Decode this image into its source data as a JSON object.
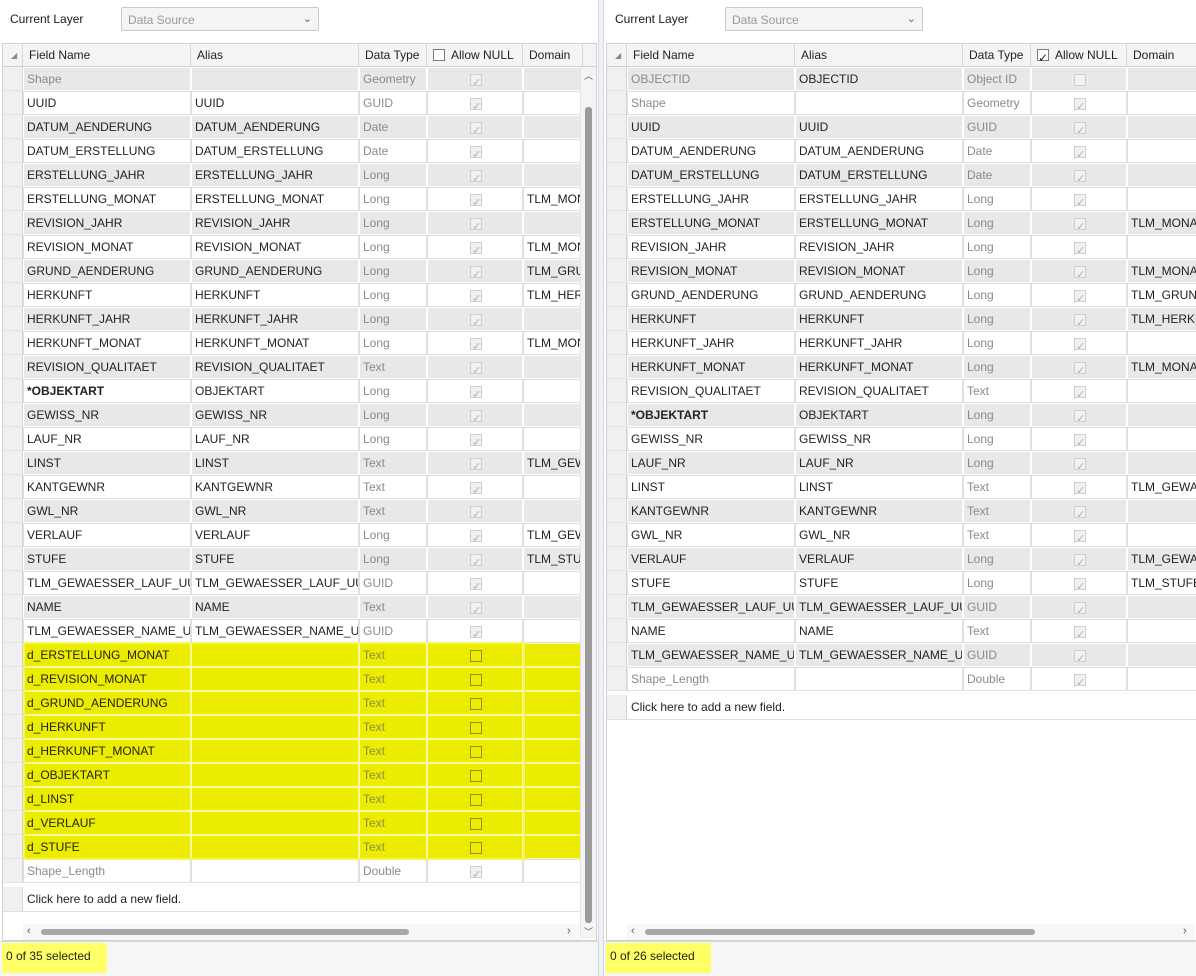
{
  "left": {
    "current_layer_label": "Current Layer",
    "data_source": "Data Source",
    "columns": [
      "Field Name",
      "Alias",
      "Data Type",
      "Allow NULL",
      "Domain"
    ],
    "allow_null_header_checked": false,
    "rows": [
      {
        "name": "Shape",
        "alias": "",
        "type": "Geometry",
        "null": true,
        "domain": "",
        "dim": true
      },
      {
        "name": "UUID",
        "alias": "UUID",
        "type": "GUID",
        "null": true,
        "domain": ""
      },
      {
        "name": "DATUM_AENDERUNG",
        "alias": "DATUM_AENDERUNG",
        "type": "Date",
        "null": true,
        "domain": ""
      },
      {
        "name": "DATUM_ERSTELLUNG",
        "alias": "DATUM_ERSTELLUNG",
        "type": "Date",
        "null": true,
        "domain": ""
      },
      {
        "name": "ERSTELLUNG_JAHR",
        "alias": "ERSTELLUNG_JAHR",
        "type": "Long",
        "null": true,
        "domain": ""
      },
      {
        "name": "ERSTELLUNG_MONAT",
        "alias": "ERSTELLUNG_MONAT",
        "type": "Long",
        "null": true,
        "domain": "TLM_MON"
      },
      {
        "name": "REVISION_JAHR",
        "alias": "REVISION_JAHR",
        "type": "Long",
        "null": true,
        "domain": ""
      },
      {
        "name": "REVISION_MONAT",
        "alias": "REVISION_MONAT",
        "type": "Long",
        "null": true,
        "domain": "TLM_MON"
      },
      {
        "name": "GRUND_AENDERUNG",
        "alias": "GRUND_AENDERUNG",
        "type": "Long",
        "null": true,
        "domain": "TLM_GRU"
      },
      {
        "name": "HERKUNFT",
        "alias": "HERKUNFT",
        "type": "Long",
        "null": true,
        "domain": "TLM_HERK"
      },
      {
        "name": "HERKUNFT_JAHR",
        "alias": "HERKUNFT_JAHR",
        "type": "Long",
        "null": true,
        "domain": ""
      },
      {
        "name": "HERKUNFT_MONAT",
        "alias": "HERKUNFT_MONAT",
        "type": "Long",
        "null": true,
        "domain": "TLM_MON"
      },
      {
        "name": "REVISION_QUALITAET",
        "alias": "REVISION_QUALITAET",
        "type": "Text",
        "null": true,
        "domain": ""
      },
      {
        "name": "*OBJEKTART",
        "alias": "OBJEKTART",
        "type": "Long",
        "null": true,
        "domain": "",
        "bold": true
      },
      {
        "name": "GEWISS_NR",
        "alias": "GEWISS_NR",
        "type": "Long",
        "null": true,
        "domain": ""
      },
      {
        "name": "LAUF_NR",
        "alias": "LAUF_NR",
        "type": "Long",
        "null": true,
        "domain": ""
      },
      {
        "name": "LINST",
        "alias": "LINST",
        "type": "Text",
        "null": true,
        "domain": "TLM_GEW"
      },
      {
        "name": "KANTGEWNR",
        "alias": "KANTGEWNR",
        "type": "Text",
        "null": true,
        "domain": ""
      },
      {
        "name": "GWL_NR",
        "alias": "GWL_NR",
        "type": "Text",
        "null": true,
        "domain": ""
      },
      {
        "name": "VERLAUF",
        "alias": "VERLAUF",
        "type": "Long",
        "null": true,
        "domain": "TLM_GEW"
      },
      {
        "name": "STUFE",
        "alias": "STUFE",
        "type": "Long",
        "null": true,
        "domain": "TLM_STUF"
      },
      {
        "name": "TLM_GEWAESSER_LAUF_UUID",
        "alias": "TLM_GEWAESSER_LAUF_UUID",
        "type": "GUID",
        "null": true,
        "domain": ""
      },
      {
        "name": "NAME",
        "alias": "NAME",
        "type": "Text",
        "null": true,
        "domain": ""
      },
      {
        "name": "TLM_GEWAESSER_NAME_UUID",
        "alias": "TLM_GEWAESSER_NAME_UUID",
        "type": "GUID",
        "null": true,
        "domain": ""
      },
      {
        "name": "d_ERSTELLUNG_MONAT",
        "alias": "",
        "type": "Text",
        "null": false,
        "domain": "",
        "hl": true
      },
      {
        "name": "d_REVISION_MONAT",
        "alias": "",
        "type": "Text",
        "null": false,
        "domain": "",
        "hl": true
      },
      {
        "name": "d_GRUND_AENDERUNG",
        "alias": "",
        "type": "Text",
        "null": false,
        "domain": "",
        "hl": true
      },
      {
        "name": "d_HERKUNFT",
        "alias": "",
        "type": "Text",
        "null": false,
        "domain": "",
        "hl": true
      },
      {
        "name": "d_HERKUNFT_MONAT",
        "alias": "",
        "type": "Text",
        "null": false,
        "domain": "",
        "hl": true
      },
      {
        "name": "d_OBJEKTART",
        "alias": "",
        "type": "Text",
        "null": false,
        "domain": "",
        "hl": true
      },
      {
        "name": "d_LINST",
        "alias": "",
        "type": "Text",
        "null": false,
        "domain": "",
        "hl": true
      },
      {
        "name": "d_VERLAUF",
        "alias": "",
        "type": "Text",
        "null": false,
        "domain": "",
        "hl": true
      },
      {
        "name": "d_STUFE",
        "alias": "",
        "type": "Text",
        "null": false,
        "domain": "",
        "hl": true
      },
      {
        "name": "Shape_Length",
        "alias": "",
        "type": "Double",
        "null": true,
        "domain": "",
        "dim": true
      }
    ],
    "add_field": "Click here to add a new field.",
    "status": "0 of 35 selected"
  },
  "right": {
    "current_layer_label": "Current Layer",
    "data_source": "Data Source",
    "columns": [
      "Field Name",
      "Alias",
      "Data Type",
      "Allow NULL",
      "Domain"
    ],
    "allow_null_header_checked": true,
    "rows": [
      {
        "name": "OBJECTID",
        "alias": "OBJECTID",
        "type": "Object ID",
        "null": false,
        "domain": "",
        "dim": true
      },
      {
        "name": "Shape",
        "alias": "",
        "type": "Geometry",
        "null": true,
        "domain": "",
        "dim": true
      },
      {
        "name": "UUID",
        "alias": "UUID",
        "type": "GUID",
        "null": true,
        "domain": ""
      },
      {
        "name": "DATUM_AENDERUNG",
        "alias": "DATUM_AENDERUNG",
        "type": "Date",
        "null": true,
        "domain": ""
      },
      {
        "name": "DATUM_ERSTELLUNG",
        "alias": "DATUM_ERSTELLUNG",
        "type": "Date",
        "null": true,
        "domain": ""
      },
      {
        "name": "ERSTELLUNG_JAHR",
        "alias": "ERSTELLUNG_JAHR",
        "type": "Long",
        "null": true,
        "domain": ""
      },
      {
        "name": "ERSTELLUNG_MONAT",
        "alias": "ERSTELLUNG_MONAT",
        "type": "Long",
        "null": true,
        "domain": "TLM_MONAT"
      },
      {
        "name": "REVISION_JAHR",
        "alias": "REVISION_JAHR",
        "type": "Long",
        "null": true,
        "domain": ""
      },
      {
        "name": "REVISION_MONAT",
        "alias": "REVISION_MONAT",
        "type": "Long",
        "null": true,
        "domain": "TLM_MONAT"
      },
      {
        "name": "GRUND_AENDERUNG",
        "alias": "GRUND_AENDERUNG",
        "type": "Long",
        "null": true,
        "domain": "TLM_GRUND"
      },
      {
        "name": "HERKUNFT",
        "alias": "HERKUNFT",
        "type": "Long",
        "null": true,
        "domain": "TLM_HERKUI"
      },
      {
        "name": "HERKUNFT_JAHR",
        "alias": "HERKUNFT_JAHR",
        "type": "Long",
        "null": true,
        "domain": ""
      },
      {
        "name": "HERKUNFT_MONAT",
        "alias": "HERKUNFT_MONAT",
        "type": "Long",
        "null": true,
        "domain": "TLM_MONAT"
      },
      {
        "name": "REVISION_QUALITAET",
        "alias": "REVISION_QUALITAET",
        "type": "Text",
        "null": true,
        "domain": ""
      },
      {
        "name": "*OBJEKTART",
        "alias": "OBJEKTART",
        "type": "Long",
        "null": true,
        "domain": "",
        "bold": true
      },
      {
        "name": "GEWISS_NR",
        "alias": "GEWISS_NR",
        "type": "Long",
        "null": true,
        "domain": ""
      },
      {
        "name": "LAUF_NR",
        "alias": "LAUF_NR",
        "type": "Long",
        "null": true,
        "domain": ""
      },
      {
        "name": "LINST",
        "alias": "LINST",
        "type": "Text",
        "null": true,
        "domain": "TLM_GEWAE"
      },
      {
        "name": "KANTGEWNR",
        "alias": "KANTGEWNR",
        "type": "Text",
        "null": true,
        "domain": ""
      },
      {
        "name": "GWL_NR",
        "alias": "GWL_NR",
        "type": "Text",
        "null": true,
        "domain": ""
      },
      {
        "name": "VERLAUF",
        "alias": "VERLAUF",
        "type": "Long",
        "null": true,
        "domain": "TLM_GEWAE"
      },
      {
        "name": "STUFE",
        "alias": "STUFE",
        "type": "Long",
        "null": true,
        "domain": "TLM_STUFE_("
      },
      {
        "name": "TLM_GEWAESSER_LAUF_UUID",
        "alias": "TLM_GEWAESSER_LAUF_UUID",
        "type": "GUID",
        "null": true,
        "domain": ""
      },
      {
        "name": "NAME",
        "alias": "NAME",
        "type": "Text",
        "null": true,
        "domain": ""
      },
      {
        "name": "TLM_GEWAESSER_NAME_UUID",
        "alias": "TLM_GEWAESSER_NAME_UUID",
        "type": "GUID",
        "null": true,
        "domain": ""
      },
      {
        "name": "Shape_Length",
        "alias": "",
        "type": "Double",
        "null": true,
        "domain": "",
        "dim": true
      }
    ],
    "add_field": "Click here to add a new field.",
    "status": "0 of 26 selected"
  },
  "icons": {
    "dropdown": "chevron-down-icon",
    "check": "check-icon",
    "sort": "sort-corner-icon",
    "scroll_up": "chevron-up-icon",
    "scroll_down": "chevron-down-icon",
    "scroll_left": "chevron-left-icon",
    "scroll_right": "chevron-right-icon"
  },
  "colors": {
    "highlight": "#ecec00",
    "status_highlight": "#ffff66",
    "row_alt": "#e8e8e8"
  }
}
